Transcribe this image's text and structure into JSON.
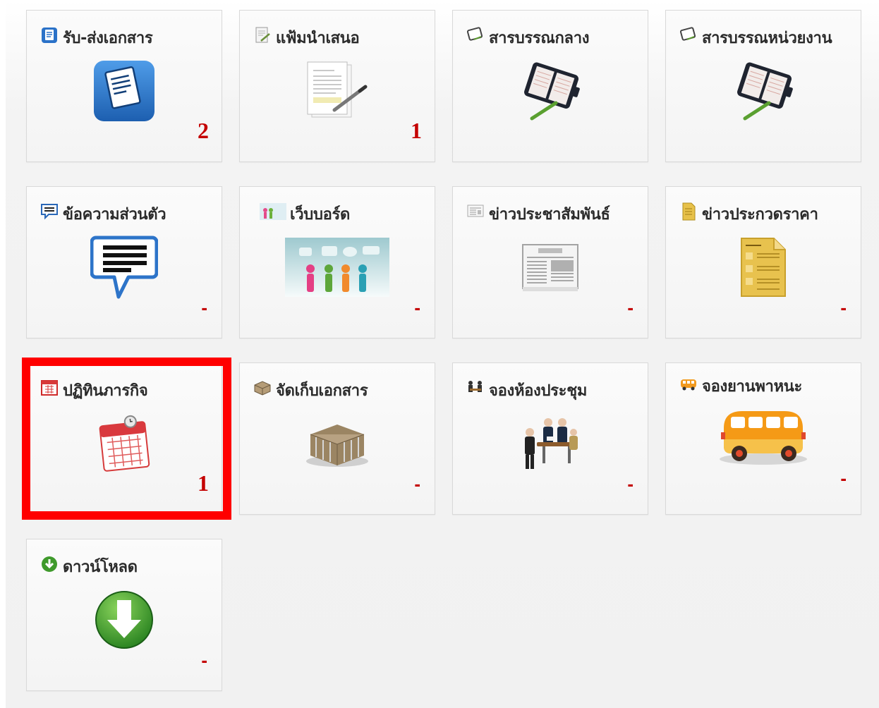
{
  "tiles": [
    {
      "title": "รับ-ส่งเอกสาร",
      "count": "2",
      "small_icon": "document-stack-icon",
      "big_icon": "document-icon"
    },
    {
      "title": "แฟ้มนำเสนอ",
      "count": "1",
      "small_icon": "pencil-document-icon",
      "big_icon": "signing-document-icon"
    },
    {
      "title": "สารบรรณกลาง",
      "count": "",
      "small_icon": "planner-small-icon",
      "big_icon": "planner-icon"
    },
    {
      "title": "สารบรรณหน่วยงาน",
      "count": "",
      "small_icon": "planner-small-icon",
      "big_icon": "planner-icon"
    },
    {
      "title": "ข้อความส่วนตัว",
      "count": "-",
      "small_icon": "chat-small-icon",
      "big_icon": "chat-bubble-icon"
    },
    {
      "title": "เว็บบอร์ด",
      "count": "-",
      "small_icon": "people-small-icon",
      "big_icon": "people-discussion-icon"
    },
    {
      "title": "ข่าวประชาสัมพันธ์",
      "count": "-",
      "small_icon": "newspaper-small-icon",
      "big_icon": "newspaper-icon"
    },
    {
      "title": "ข่าวประกวดราคา",
      "count": "-",
      "small_icon": "document-yellow-small-icon",
      "big_icon": "document-yellow-icon"
    },
    {
      "title": "ปฏิทินภารกิจ",
      "count": "1",
      "small_icon": "calendar-small-icon",
      "big_icon": "calendar-icon"
    },
    {
      "title": "จัดเก็บเอกสาร",
      "count": "-",
      "small_icon": "box-small-icon",
      "big_icon": "archive-box-icon"
    },
    {
      "title": "จองห้องประชุม",
      "count": "-",
      "small_icon": "meeting-small-icon",
      "big_icon": "meeting-people-icon"
    },
    {
      "title": "จองยานพาหนะ",
      "count": "-",
      "small_icon": "bus-small-icon",
      "big_icon": "bus-icon"
    },
    {
      "title": "ดาวน์โหลด",
      "count": "-",
      "small_icon": "download-small-icon",
      "big_icon": "download-icon"
    }
  ],
  "colors": {
    "count": "#c40000",
    "highlight": "#ff0000",
    "title": "#2b2b2b"
  }
}
